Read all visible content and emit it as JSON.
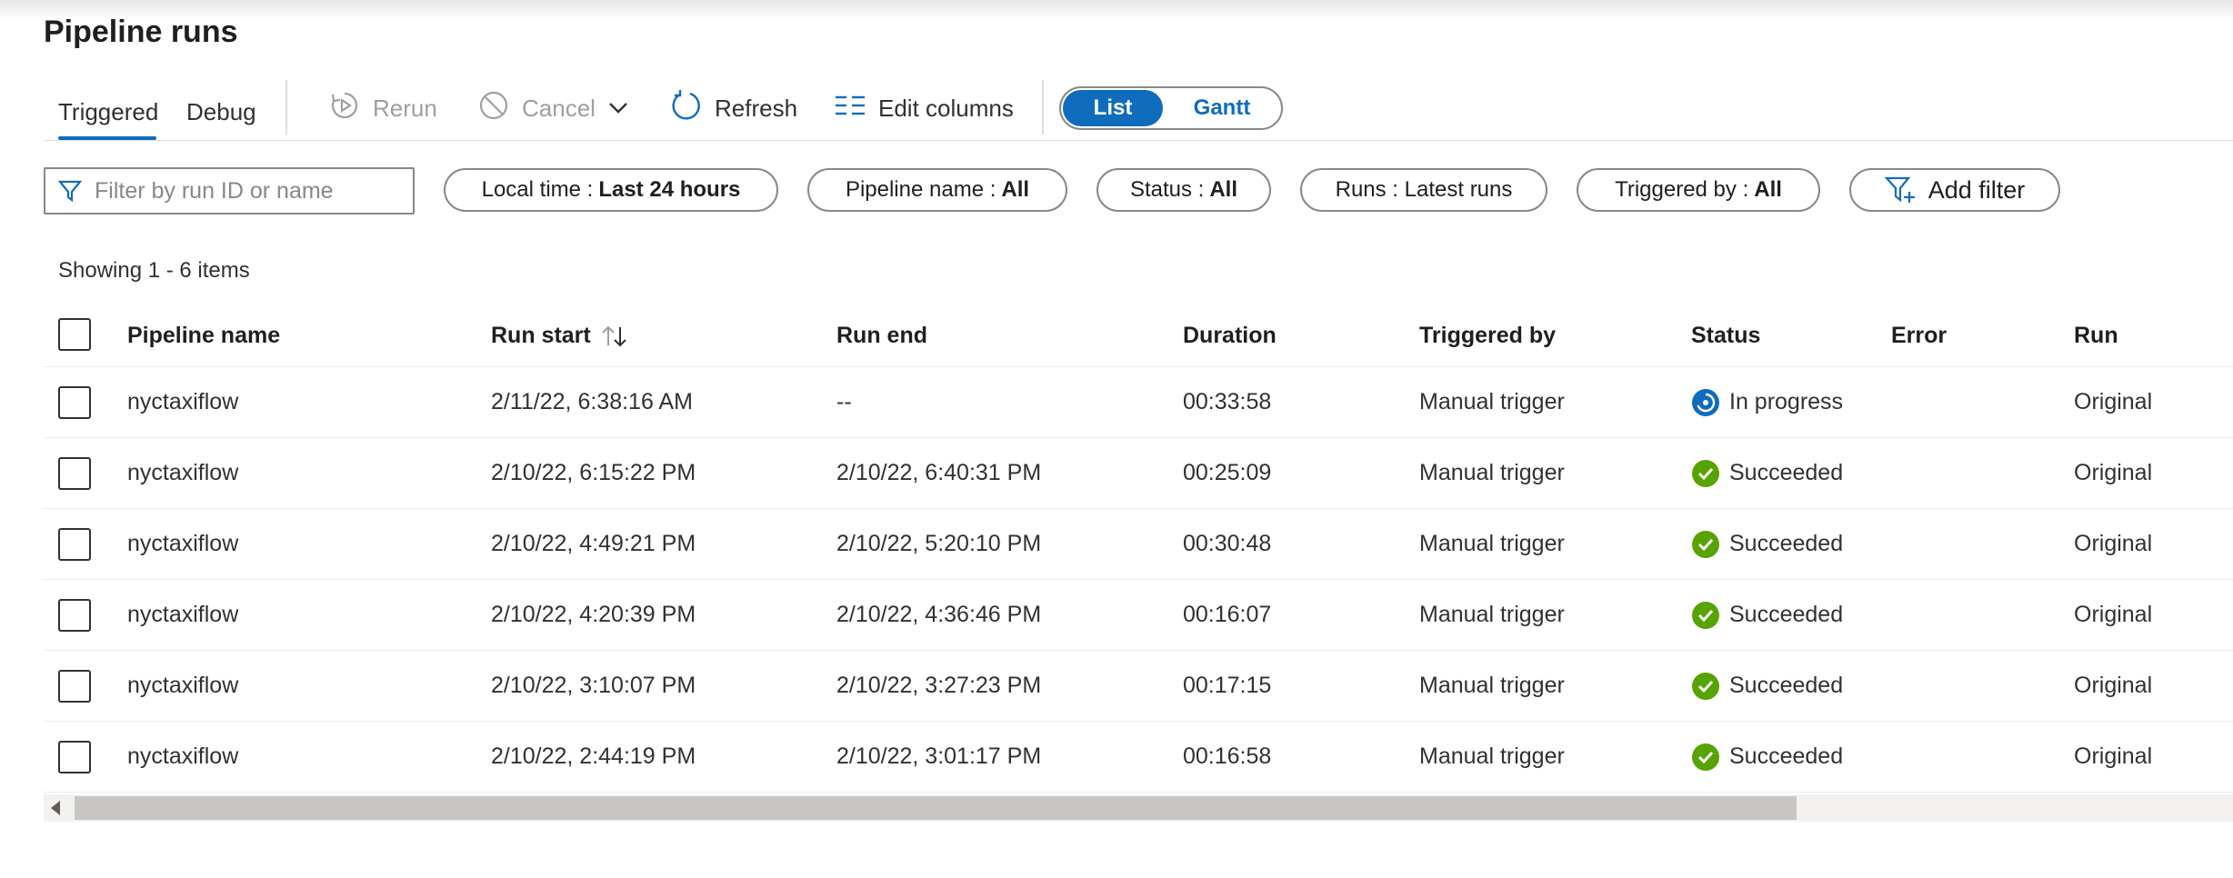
{
  "page": {
    "title": "Pipeline runs"
  },
  "toolbar": {
    "tabs": [
      {
        "label": "Triggered",
        "selected": true
      },
      {
        "label": "Debug",
        "selected": false
      }
    ],
    "rerun_label": "Rerun",
    "cancel_label": "Cancel",
    "refresh_label": "Refresh",
    "edit_columns_label": "Edit columns",
    "view_toggle": {
      "list": "List",
      "gantt": "Gantt",
      "selected": "List"
    }
  },
  "filters": {
    "search_placeholder": "Filter by run ID or name",
    "search_value": "",
    "local_time": {
      "label": "Local time :",
      "value": "Last 24 hours"
    },
    "pipeline_name": {
      "label": "Pipeline name :",
      "value": "All"
    },
    "status": {
      "label": "Status :",
      "value": "All"
    },
    "runs": {
      "label": "Runs : Latest runs"
    },
    "triggered_by": {
      "label": "Triggered by :",
      "value": "All"
    },
    "add_filter_label": "Add filter"
  },
  "summary": {
    "showing": "Showing 1 - 6 items"
  },
  "table": {
    "columns": {
      "pipeline_name": "Pipeline name",
      "run_start": "Run start",
      "run_end": "Run end",
      "duration": "Duration",
      "triggered_by": "Triggered by",
      "status": "Status",
      "error": "Error",
      "run": "Run"
    },
    "rows": [
      {
        "name": "nyctaxiflow",
        "start": "2/11/22, 6:38:16 AM",
        "end": "--",
        "duration": "00:33:58",
        "triggered_by": "Manual trigger",
        "status": "In progress",
        "status_icon": "in-progress-icon",
        "error": "",
        "run": "Original"
      },
      {
        "name": "nyctaxiflow",
        "start": "2/10/22, 6:15:22 PM",
        "end": "2/10/22, 6:40:31 PM",
        "duration": "00:25:09",
        "triggered_by": "Manual trigger",
        "status": "Succeeded",
        "status_icon": "success-icon",
        "error": "",
        "run": "Original"
      },
      {
        "name": "nyctaxiflow",
        "start": "2/10/22, 4:49:21 PM",
        "end": "2/10/22, 5:20:10 PM",
        "duration": "00:30:48",
        "triggered_by": "Manual trigger",
        "status": "Succeeded",
        "status_icon": "success-icon",
        "error": "",
        "run": "Original"
      },
      {
        "name": "nyctaxiflow",
        "start": "2/10/22, 4:20:39 PM",
        "end": "2/10/22, 4:36:46 PM",
        "duration": "00:16:07",
        "triggered_by": "Manual trigger",
        "status": "Succeeded",
        "status_icon": "success-icon",
        "error": "",
        "run": "Original"
      },
      {
        "name": "nyctaxiflow",
        "start": "2/10/22, 3:10:07 PM",
        "end": "2/10/22, 3:27:23 PM",
        "duration": "00:17:15",
        "triggered_by": "Manual trigger",
        "status": "Succeeded",
        "status_icon": "success-icon",
        "error": "",
        "run": "Original"
      },
      {
        "name": "nyctaxiflow",
        "start": "2/10/22, 2:44:19 PM",
        "end": "2/10/22, 3:01:17 PM",
        "duration": "00:16:58",
        "triggered_by": "Manual trigger",
        "status": "Succeeded",
        "status_icon": "success-icon",
        "error": "",
        "run": "Original"
      }
    ]
  },
  "colors": {
    "accent": "#0f6cbd",
    "success": "#57a300",
    "in_progress": "#0f6cbd",
    "disabled_text": "#a19f9d"
  }
}
